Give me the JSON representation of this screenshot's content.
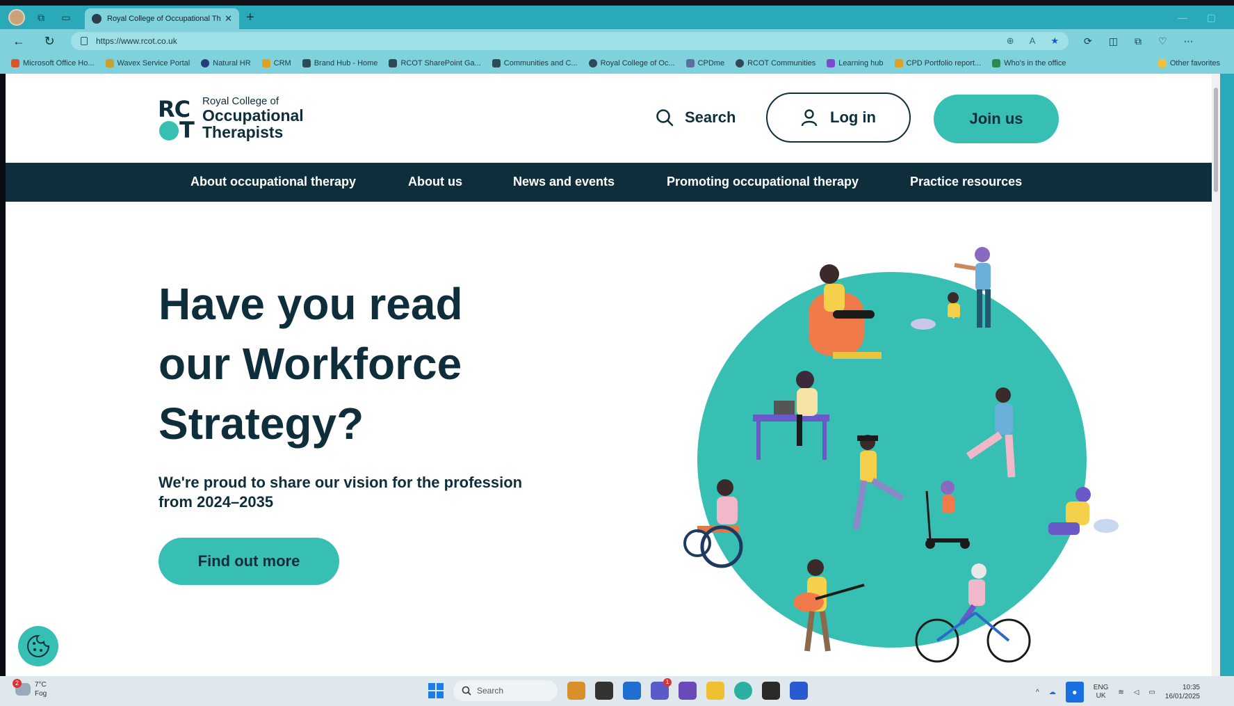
{
  "browser": {
    "tab_title": "Royal College of Occupational Th",
    "url": "https://www.rcot.co.uk",
    "bookmarks": [
      "Microsoft Office Ho...",
      "Wavex Service Portal",
      "Natural HR",
      "CRM",
      "Brand Hub - Home",
      "RCOT SharePoint Ga...",
      "Communities and C...",
      "Royal College of Oc...",
      "CPDme",
      "RCOT Communities",
      "Learning hub",
      "CPD Portfolio report...",
      "Who's in the office"
    ],
    "other_favorites": "Other favorites"
  },
  "site": {
    "logo": {
      "small": "Royal College of",
      "line1": "Occupational",
      "line2": "Therapists"
    },
    "search_label": "Search",
    "login_label": "Log in",
    "join_label": "Join us",
    "nav": [
      "About occupational therapy",
      "About us",
      "News and events",
      "Promoting occupational therapy",
      "Practice resources"
    ],
    "hero": {
      "line1": "Have you read",
      "line2": "our Workforce",
      "line3": "Strategy?",
      "subtitle": "We're proud to share our vision for the profession from 2024–2035",
      "cta": "Find out more"
    },
    "colors": {
      "brand_dark": "#0d2e3a",
      "brand_teal": "#37bfb4"
    }
  },
  "taskbar": {
    "weather_temp": "7°C",
    "weather_desc": "Fog",
    "weather_badge": "2",
    "search_placeholder": "Search",
    "lang1": "ENG",
    "lang2": "UK",
    "time": "10:35",
    "date": "16/01/2025",
    "teams_badge": "1"
  }
}
